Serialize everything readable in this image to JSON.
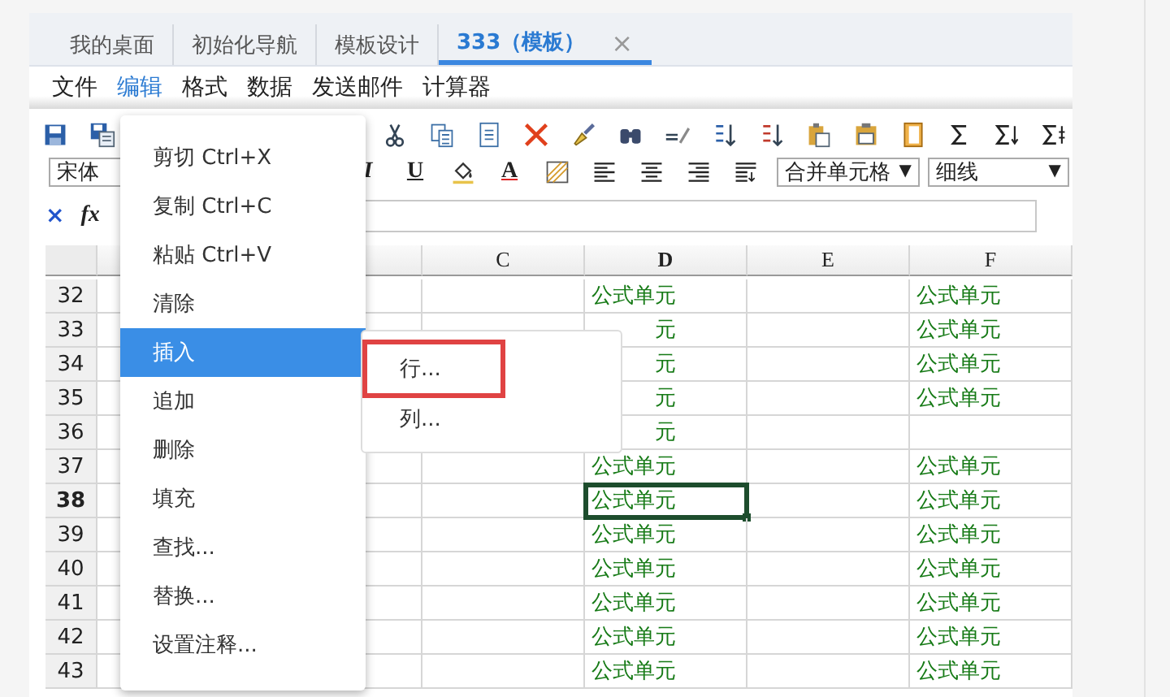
{
  "tabs": [
    {
      "label": "我的桌面",
      "selected": false
    },
    {
      "label": "初始化导航",
      "selected": false
    },
    {
      "label": "模板设计",
      "selected": false
    },
    {
      "label": "333（模板）",
      "selected": true,
      "close": "×"
    }
  ],
  "menu_bar": [
    {
      "label": "文件",
      "selected": false
    },
    {
      "label": "编辑",
      "selected": true
    },
    {
      "label": "格式",
      "selected": false
    },
    {
      "label": "数据",
      "selected": false
    },
    {
      "label": "发送邮件",
      "selected": false
    },
    {
      "label": "计算器",
      "selected": false
    }
  ],
  "toolbar": {
    "row_1": [
      {
        "kind": "icon"
      },
      {
        "kind": "icon"
      },
      {
        "kind": "gap"
      },
      {
        "kind": "icon"
      },
      {
        "kind": "icon"
      },
      {
        "kind": "icon"
      },
      {
        "kind": "icon"
      },
      {
        "kind": "icon"
      },
      {
        "kind": "icon"
      },
      {
        "kind": "icon"
      },
      {
        "kind": "icon"
      },
      {
        "kind": "icon"
      },
      {
        "kind": "icon"
      },
      {
        "kind": "icon"
      },
      {
        "kind": "icon"
      },
      {
        "kind": "icon"
      },
      {
        "kind": "icon"
      },
      {
        "kind": "icon"
      }
    ],
    "row_2": [
      {
        "kind": "select",
        "value": "宋体"
      },
      {
        "kind": "gap"
      },
      {
        "kind": "glyph",
        "text": "I"
      },
      {
        "kind": "glyph",
        "text": "U"
      },
      {
        "kind": "icon"
      },
      {
        "kind": "glyph",
        "text": "A"
      },
      {
        "kind": "icon"
      },
      {
        "kind": "icon"
      },
      {
        "kind": "icon"
      },
      {
        "kind": "icon"
      },
      {
        "kind": "icon"
      },
      {
        "kind": "select",
        "value": "合并单元格",
        "arrow": "▼"
      },
      {
        "kind": "select",
        "value": "细线",
        "arrow": "▼"
      }
    ]
  },
  "formula_bar": {
    "cancel": "×",
    "fx": "fx"
  },
  "grid": {
    "columns": [
      {
        "label": "C",
        "selected": false
      },
      {
        "label": "D",
        "selected": true
      },
      {
        "label": "E",
        "selected": false
      },
      {
        "label": "F",
        "selected": false
      }
    ],
    "rows": [
      {
        "number": "32",
        "selected": false,
        "D": "公式单元",
        "F": "公式单元"
      },
      {
        "number": "33",
        "selected": false,
        "D": "元",
        "D_covered": true,
        "F": "公式单元"
      },
      {
        "number": "34",
        "selected": false,
        "D": "元",
        "D_covered": true,
        "F": "公式单元"
      },
      {
        "number": "35",
        "selected": false,
        "D": "元",
        "D_covered": true,
        "F": "公式单元"
      },
      {
        "number": "36",
        "selected": false,
        "D": "元",
        "D_covered": true
      },
      {
        "number": "37",
        "selected": false,
        "D": "公式单元",
        "F": "公式单元"
      },
      {
        "number": "38",
        "selected": true,
        "D": "公式单元",
        "F": "公式单元"
      },
      {
        "number": "39",
        "selected": false,
        "D": "公式单元",
        "F": "公式单元"
      },
      {
        "number": "40",
        "selected": false,
        "D": "公式单元",
        "F": "公式单元"
      },
      {
        "number": "41",
        "selected": false,
        "D": "公式单元",
        "F": "公式单元"
      },
      {
        "number": "42",
        "selected": false,
        "D": "公式单元",
        "F": "公式单元"
      },
      {
        "number": "43",
        "selected": false,
        "D": "公式单元",
        "F": "公式单元"
      }
    ]
  },
  "context_menu": [
    {
      "label": "剪切 Ctrl+X",
      "selected": false
    },
    {
      "label": "复制 Ctrl+C",
      "selected": false
    },
    {
      "label": "粘贴 Ctrl+V",
      "selected": false
    },
    {
      "label": "清除",
      "selected": false
    },
    {
      "label": "插入",
      "selected": true
    },
    {
      "label": "追加",
      "selected": false
    },
    {
      "label": "删除",
      "selected": false
    },
    {
      "label": "填充",
      "selected": false
    },
    {
      "label": "查找...",
      "selected": false
    },
    {
      "label": "替换...",
      "selected": false
    },
    {
      "label": "设置注释...",
      "selected": false
    }
  ],
  "submenu": [
    {
      "label": "行...",
      "selected": true
    },
    {
      "label": "列...",
      "selected": false
    }
  ]
}
